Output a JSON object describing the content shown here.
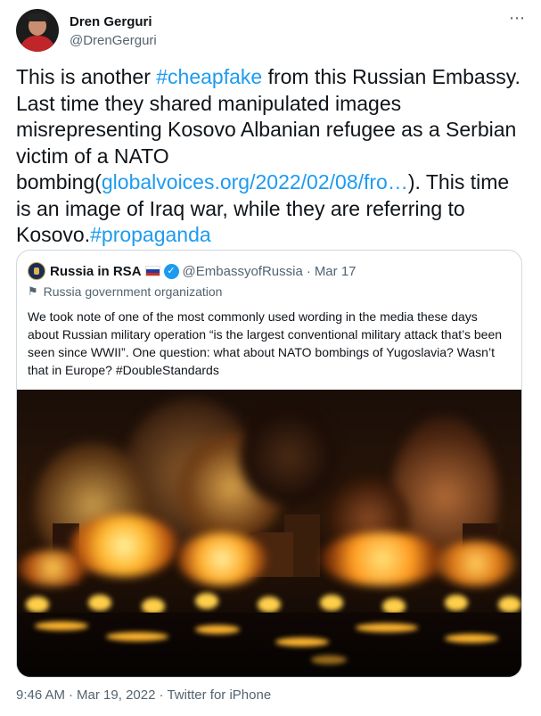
{
  "author": {
    "name": "Dren Gerguri",
    "handle": "@DrenGerguri"
  },
  "more_icon": "⋯",
  "tweet": {
    "text_1": "This is another ",
    "hashtag_1": "#cheapfake",
    "text_2": " from this Russian Embassy. Last time they shared manipulated images misrepresenting Kosovo Albanian refugee as a Serbian victim of a NATO bombing(",
    "link": "globalvoices.org/2022/02/08/fro…",
    "text_3": "). This time is an image of Iraq war, while they are referring to Kosovo.",
    "hashtag_2": "#propaganda"
  },
  "quoted": {
    "name": "Russia in RSA",
    "handle": "@EmbassyofRussia",
    "date": "Mar 17",
    "org_label": "Russia government organization",
    "text": "We took note of one of the most commonly used wording in the media these days about Russian military operation “is the largest conventional military attack that’s been seen since WWII”. One question: what about NATO bombings of Yugoslavia? Wasn’t that in Europe? #DoubleStandards",
    "photo_name": "night-city-bombing-photo"
  },
  "footer": {
    "time": "9:46 AM",
    "date": "Mar 19, 2022",
    "source": "Twitter for iPhone"
  },
  "colors": {
    "link": "#1d9bf0",
    "secondary_text": "#536471",
    "border": "#cfd9de"
  },
  "icons": [
    "avatar",
    "more-icon",
    "flag-russia-icon",
    "verified-badge-icon",
    "government-flag-icon"
  ]
}
